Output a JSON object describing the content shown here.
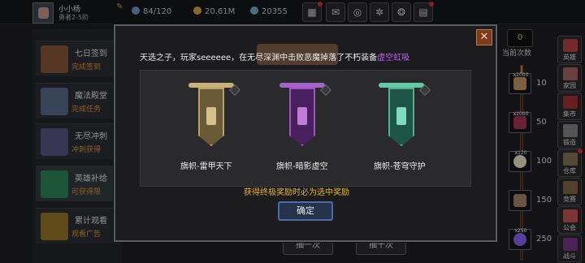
{
  "player": {
    "name": "小小杨",
    "rank": "勇者2-5阶"
  },
  "resources": {
    "stamina": "84/120",
    "gold": "20.61M",
    "gems": "20355"
  },
  "left_list": [
    {
      "title": "七日签到",
      "sub": "完成签到",
      "color": "#8a5a3a"
    },
    {
      "title": "魔法殿堂",
      "sub": "完成任务",
      "color": "#5a6e8e"
    },
    {
      "title": "无尽冲刺",
      "sub": "冲刺获得",
      "color": "#5a5a8a"
    },
    {
      "title": "英雄补给",
      "sub": "可获得限",
      "color": "#2e8a5a"
    },
    {
      "title": "累计观看",
      "sub": "观看广告",
      "color": "#9a7a2a"
    }
  ],
  "right_menu": [
    {
      "label": "英雄",
      "color": "#b44"
    },
    {
      "label": "家园",
      "color": "#a66"
    },
    {
      "label": "集市",
      "color": "#a33"
    },
    {
      "label": "锻造",
      "color": "#888"
    },
    {
      "label": "仓库",
      "color": "#875"
    },
    {
      "label": "竞赛",
      "color": "#8a6a44"
    },
    {
      "label": "公会",
      "color": "#c55"
    },
    {
      "label": "战斗",
      "color": "#7a3a8a"
    }
  ],
  "draw_counter": {
    "value": "0",
    "label": "当前次数"
  },
  "draw_rewards": [
    {
      "qty": "x2000",
      "threshold": "10",
      "color": "#c96"
    },
    {
      "qty": "x2000",
      "threshold": "50",
      "color": "#a35"
    },
    {
      "qty": "x120",
      "threshold": "100",
      "color": "#eec"
    },
    {
      "qty": "",
      "threshold": "150",
      "color": "#a86"
    },
    {
      "qty": "x250",
      "threshold": "250",
      "color": "#86f"
    }
  ],
  "draw_buttons": {
    "once": "抽一次",
    "ten": "抽十次"
  },
  "modal": {
    "message_prefix": "天选之子，玩家seeeeee，在无尽深渊中击败恶魔掉落了不朽装备",
    "message_highlight": "虚空虹吸",
    "items": [
      {
        "name": "旗帜-雷甲天下",
        "cloth": "#6b5a36",
        "rod": "#c9b27a",
        "emblem": "#d4c08a"
      },
      {
        "name": "旗帜-暗影虚空",
        "cloth": "#4a1f5e",
        "rod": "#a463c9",
        "emblem": "#c07bdb"
      },
      {
        "name": "旗帜-苍穹守护",
        "cloth": "#1d5446",
        "rod": "#63c9a6",
        "emblem": "#7fdbbd"
      }
    ],
    "hint": "获得终极奖励时必为选中奖励",
    "confirm": "确定"
  },
  "colors": {
    "accent": "#e7b52a",
    "highlight": "#c75bff",
    "danger": "#d33"
  }
}
